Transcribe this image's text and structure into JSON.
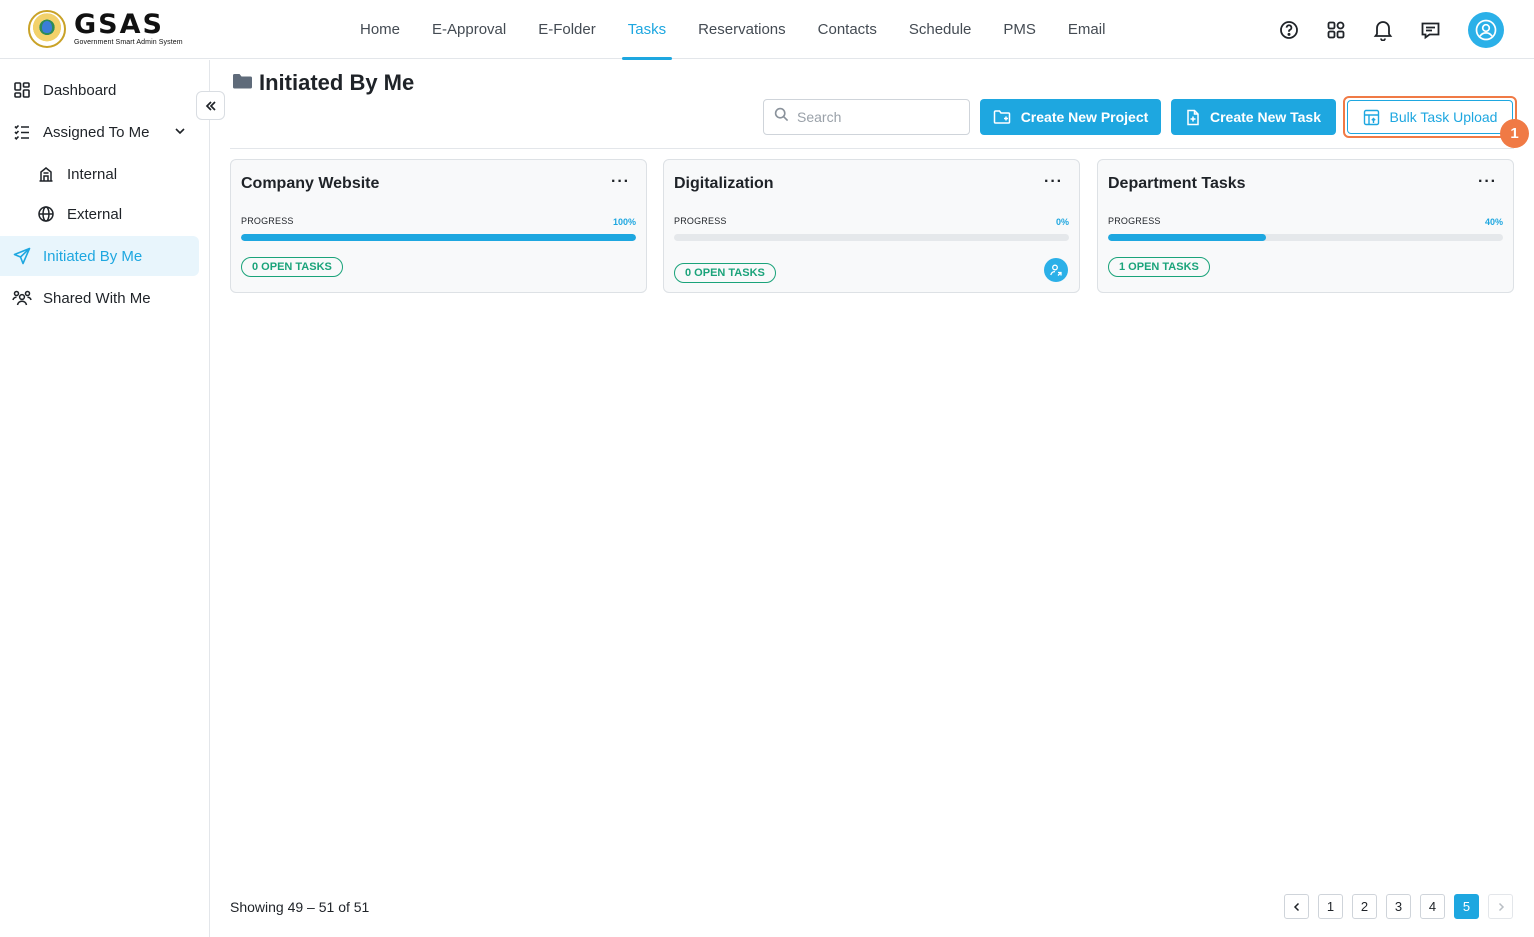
{
  "brand": {
    "title": "GSAS",
    "subtitle": "Government Smart Admin System"
  },
  "nav": [
    {
      "label": "Home",
      "active": false
    },
    {
      "label": "E-Approval",
      "active": false
    },
    {
      "label": "E-Folder",
      "active": false
    },
    {
      "label": "Tasks",
      "active": true
    },
    {
      "label": "Reservations",
      "active": false
    },
    {
      "label": "Contacts",
      "active": false
    },
    {
      "label": "Schedule",
      "active": false
    },
    {
      "label": "PMS",
      "active": false
    },
    {
      "label": "Email",
      "active": false
    }
  ],
  "top_icons": [
    "help-icon",
    "apps-grid-icon",
    "bell-icon",
    "chat-icon",
    "user-avatar-icon"
  ],
  "sidebar": {
    "items": [
      {
        "label": "Dashboard",
        "icon": "dashboard-icon"
      },
      {
        "label": "Assigned To Me",
        "icon": "checklist-icon"
      },
      {
        "label": "Internal",
        "icon": "building-icon"
      },
      {
        "label": "External",
        "icon": "globe-icon"
      },
      {
        "label": "Initiated By Me",
        "icon": "send-icon"
      },
      {
        "label": "Shared With Me",
        "icon": "users-icon"
      }
    ],
    "active": "Initiated By Me"
  },
  "page": {
    "title": "Initiated By Me"
  },
  "toolbar": {
    "search_placeholder": "Search",
    "create_project": "Create New Project",
    "create_task": "Create New Task",
    "bulk_upload": "Bulk Task Upload",
    "step_number": "1"
  },
  "progress_label": "PROGRESS",
  "projects": [
    {
      "title": "Company Website",
      "progress_text": "100%",
      "progress": 1.0,
      "open_tasks": "0 OPEN TASKS"
    },
    {
      "title": "Digitalization",
      "progress_text": "0%",
      "progress": 0.0,
      "open_tasks": "0 OPEN TASKS"
    },
    {
      "title": "Department Tasks",
      "progress_text": "40%",
      "progress": 0.4,
      "open_tasks": "1 OPEN TASKS"
    }
  ],
  "footer": {
    "showing": "Showing 49 – 51 of 51",
    "pages": [
      "1",
      "2",
      "3",
      "4",
      "5"
    ],
    "current_page": "5"
  },
  "colors": {
    "accent": "#1ea7e0",
    "success": "#1aa37a",
    "highlight": "#f07a45"
  }
}
